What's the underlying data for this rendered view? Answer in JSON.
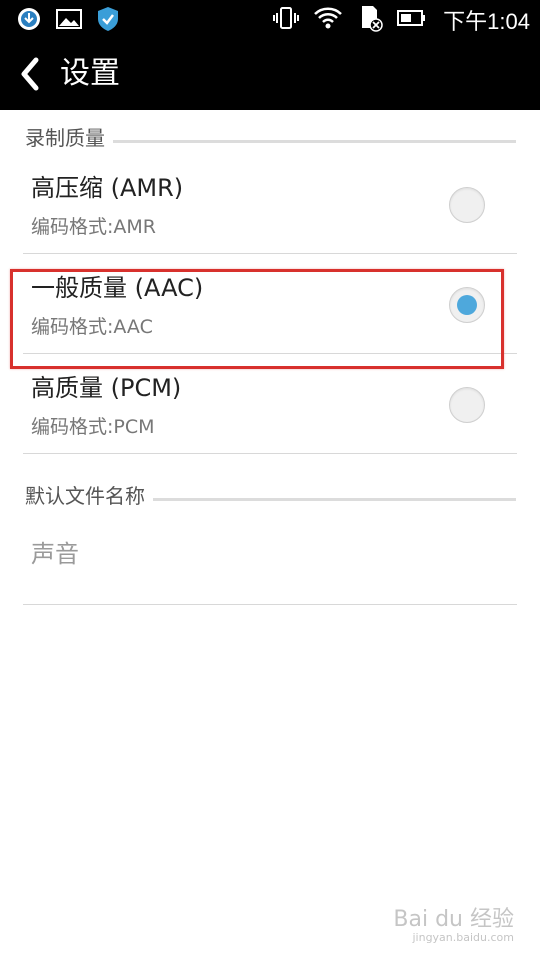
{
  "status_bar": {
    "time": "下午1:04",
    "left_icons": [
      "app-notification-icon",
      "image-icon",
      "shield-icon"
    ],
    "right_icons": [
      "vibrate-icon",
      "wifi-icon",
      "sd-card-icon",
      "battery-icon"
    ]
  },
  "action_bar": {
    "back_icon": "chevron-left-icon",
    "title": "设置"
  },
  "sections": {
    "recording_quality": {
      "header": "录制质量",
      "options": [
        {
          "title": "高压缩 (AMR)",
          "summary": "编码格式:AMR",
          "checked": false
        },
        {
          "title": "一般质量 (AAC)",
          "summary": "编码格式:AAC",
          "checked": true
        },
        {
          "title": "高质量 (PCM)",
          "summary": "编码格式:PCM",
          "checked": false
        }
      ]
    },
    "default_filename": {
      "header": "默认文件名称",
      "value": "声音"
    }
  },
  "watermark": {
    "text": "Bai du 经验",
    "sub": "jingyan.baidu.com"
  },
  "colors": {
    "accent": "#4ea8dc",
    "highlight": "#d8312d",
    "bar_bg": "#000000"
  }
}
